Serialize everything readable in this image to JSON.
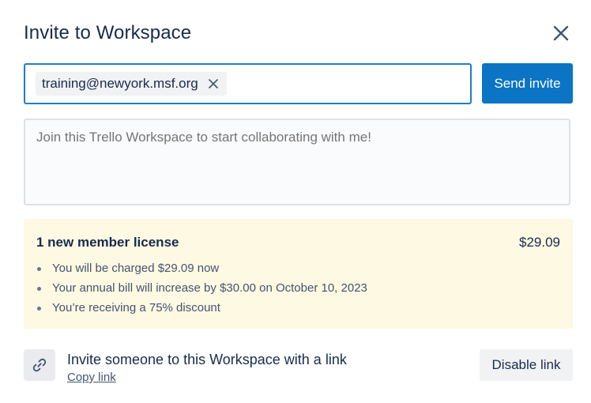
{
  "dialog": {
    "title": "Invite to Workspace",
    "close_icon": "close-icon"
  },
  "invite": {
    "emails": [
      "training@newyork.msf.org"
    ],
    "remove_icon": "close-icon",
    "send_label": "Send invite",
    "message_placeholder": "Join this Trello Workspace to start collaborating with me!",
    "message_value": ""
  },
  "license": {
    "title": "1 new member license",
    "price": "$29.09",
    "bullets": [
      "You will be charged $29.09 now",
      "Your annual bill will increase by $30.00 on October 10, 2023",
      "You’re receiving a 75% discount"
    ]
  },
  "link_invite": {
    "icon": "link-icon",
    "text": "Invite someone to this Workspace with a link",
    "copy_label": "Copy link",
    "disable_label": "Disable link"
  },
  "colors": {
    "primary_button": "#0c74c4",
    "input_focus_border": "#1f7fc8",
    "license_background": "#fdf9e3",
    "text": "#172b4d"
  }
}
